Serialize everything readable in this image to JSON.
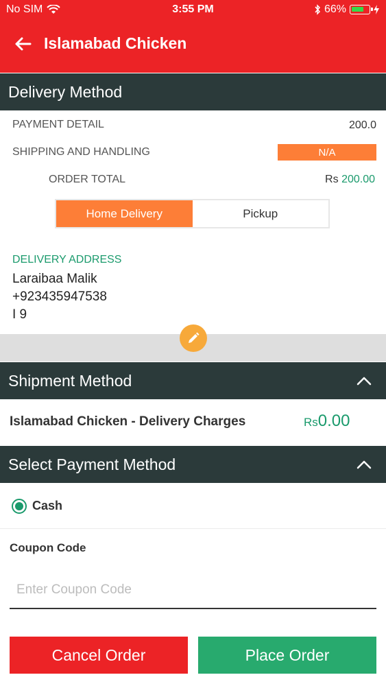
{
  "status_bar": {
    "carrier": "No SIM",
    "time": "3:55 PM",
    "battery": "66%"
  },
  "header": {
    "title": "Islamabad Chicken"
  },
  "delivery_method": {
    "title": "Delivery Method",
    "payment_detail_label": "PAYMENT DETAIL",
    "payment_detail_value": "200.0",
    "shipping_label": "SHIPPING AND HANDLING",
    "shipping_value": "N/A",
    "order_total_label": "ORDER TOTAL",
    "currency": "Rs",
    "order_total_value": "200.00",
    "options": [
      "Home Delivery",
      "Pickup"
    ],
    "address_label": "DELIVERY ADDRESS",
    "address_lines": [
      "Laraibaa Malik",
      "+923435947538",
      "I 9"
    ]
  },
  "shipment_method": {
    "title": "Shipment Method",
    "name": "Islamabad Chicken - Delivery Charges",
    "currency": "Rs",
    "price": "0.00"
  },
  "payment_method": {
    "title": "Select Payment Method",
    "option": "Cash"
  },
  "coupon": {
    "label": "Coupon Code",
    "placeholder": "Enter Coupon Code",
    "value": ""
  },
  "actions": {
    "cancel": "Cancel Order",
    "place": "Place Order"
  },
  "colors": {
    "red": "#ec2326",
    "dark_header": "#2b3a3a",
    "orange": "#fd7e37",
    "green": "#28aa6e"
  }
}
